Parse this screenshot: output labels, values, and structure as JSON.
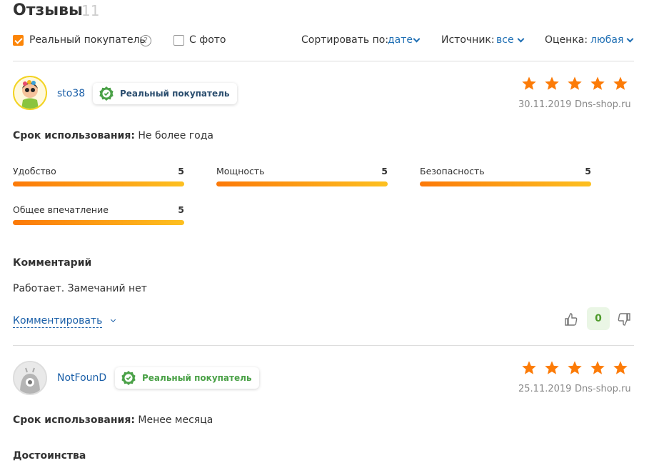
{
  "header": {
    "title": "Отзывы",
    "count": "11"
  },
  "filters": {
    "real_buyer": "Реальный покупатель",
    "with_photo": "С фото",
    "sort_label": "Сортировать по:",
    "sort_value": "дате",
    "source_label": "Источник:",
    "source_value": "все",
    "rating_label": "Оценка:",
    "rating_value": "любая"
  },
  "reviews": [
    {
      "user": "sto38",
      "badge": "Реальный покупатель",
      "stars": 5,
      "date": "30.11.2019",
      "source": "Dns-shop.ru",
      "usage_label": "Срок использования:",
      "usage_value": "Не более года",
      "ratings": [
        {
          "label": "Удобство",
          "value": "5",
          "fraction": 1.0
        },
        {
          "label": "Мощность",
          "value": "5",
          "fraction": 1.0
        },
        {
          "label": "Безопасность",
          "value": "5",
          "fraction": 1.0
        },
        {
          "label": "Общее впечатление",
          "value": "5",
          "fraction": 1.0
        }
      ],
      "comment_heading": "Комментарий",
      "comment_text": "Работает. Замечаний нет",
      "comment_link": "Комментировать",
      "votes": "0"
    },
    {
      "user": "NotFounD",
      "badge": "Реальный покупатель",
      "stars": 5,
      "date": "25.11.2019",
      "source": "Dns-shop.ru",
      "usage_label": "Срок использования:",
      "usage_value": "Менее месяца",
      "section_heading": "Достоинства"
    }
  ],
  "colors": {
    "accent": "#fc8507",
    "link": "#1a5fa8",
    "star": "#fc7b07",
    "badge_green": "#4aa147"
  }
}
